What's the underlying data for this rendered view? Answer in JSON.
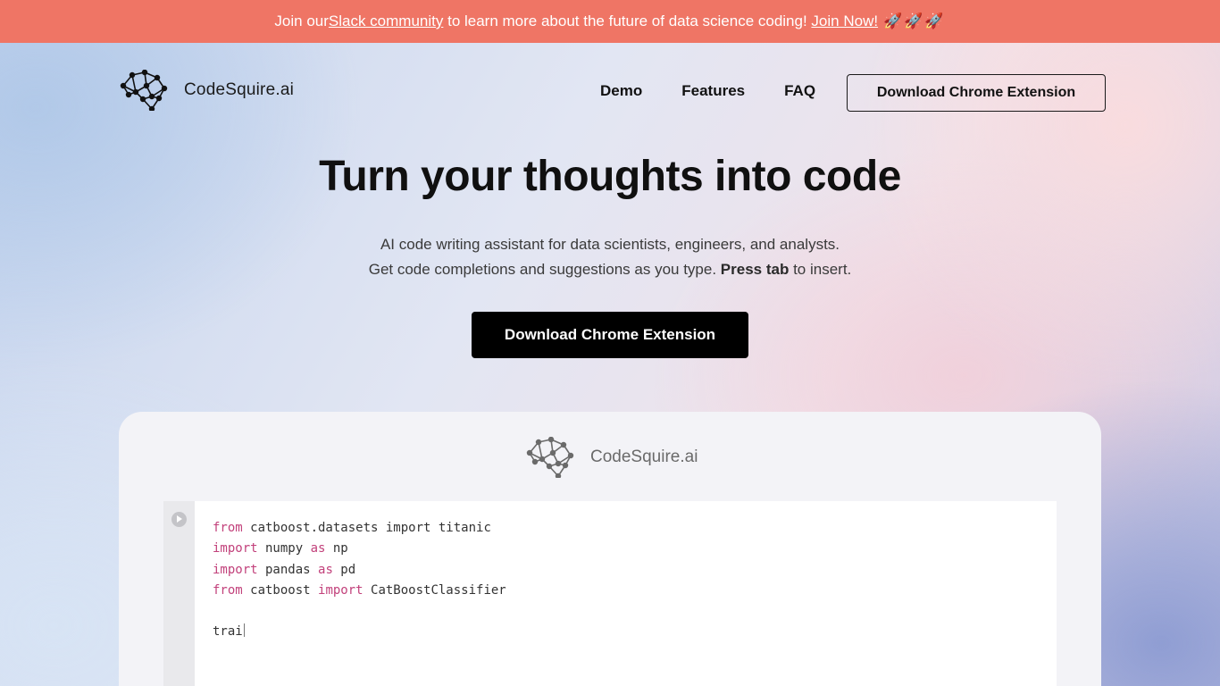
{
  "banner": {
    "text_before": "Join our ",
    "slack_link": "Slack community",
    "text_middle": " to learn more about the future of data science coding! ",
    "join_link": "Join Now!",
    "emoji": "🚀🚀🚀",
    "background_color": "#ef7565"
  },
  "header": {
    "brand_name": "CodeSquire.ai",
    "logo_icon": "network-brain-logo-icon",
    "nav": {
      "demo": "Demo",
      "features": "Features",
      "faq": "FAQ"
    },
    "cta_label": "Download Chrome Extension"
  },
  "hero": {
    "title": "Turn your thoughts into code",
    "subtitle_line1": "AI code writing assistant for data scientists, engineers, and analysts.",
    "subtitle_line2_before": "Get code completions and suggestions as you type. ",
    "subtitle_line2_bold": "Press tab",
    "subtitle_line2_after": " to insert.",
    "cta_label": "Download Chrome Extension",
    "cta_color": "#000000"
  },
  "demo": {
    "brand_name": "CodeSquire.ai",
    "run_icon": "play-icon",
    "keyword_color": "#c2417b",
    "code": {
      "line1": {
        "kw": "from",
        "rest": " catboost.datasets import titanic"
      },
      "line2": {
        "kw1": "import",
        "mid": " numpy ",
        "kw2": "as",
        "rest": " np"
      },
      "line3": {
        "kw1": "import",
        "mid": " pandas ",
        "kw2": "as",
        "rest": " pd"
      },
      "line4": {
        "kw1": "from",
        "mid": " catboost ",
        "kw2": "import",
        "rest": " CatBoostClassifier"
      },
      "line6": {
        "text": "trai"
      }
    }
  }
}
